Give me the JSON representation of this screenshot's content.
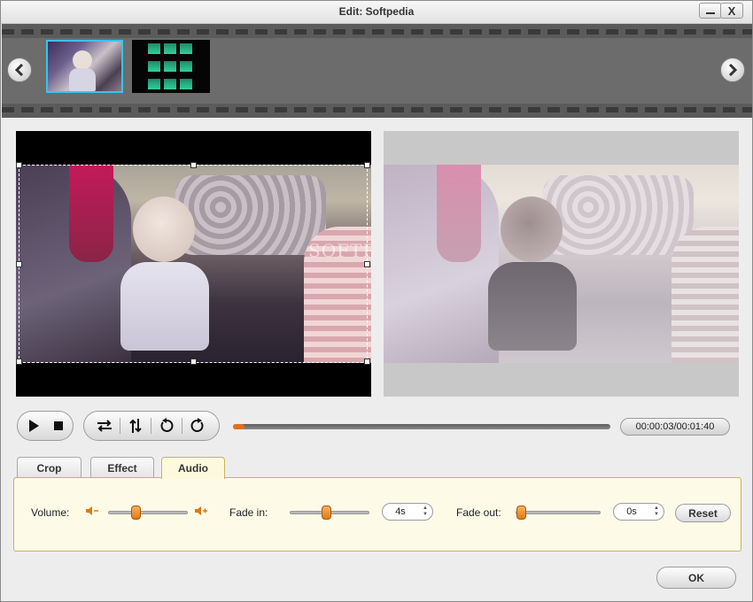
{
  "window": {
    "title": "Edit: Softpedia"
  },
  "titlebar": {
    "minimize_icon": "minimize-icon",
    "close_label": "X"
  },
  "filmstrip": {
    "prev_icon": "chevron-left-icon",
    "next_icon": "chevron-right-icon",
    "selected_index": 0,
    "clip_count": 2
  },
  "preview": {
    "watermark": "SOFTPEDIA"
  },
  "player": {
    "timecode": "00:00:03/00:01:40",
    "progress_fraction": 0.03,
    "icons": [
      "play-icon",
      "stop-icon",
      "flip-horizontal-icon",
      "flip-vertical-icon",
      "rotate-left-icon",
      "rotate-right-icon"
    ]
  },
  "tabs": [
    {
      "label": "Crop",
      "active": false
    },
    {
      "label": "Effect",
      "active": false
    },
    {
      "label": "Audio",
      "active": true
    }
  ],
  "audio": {
    "volume_label": "Volume:",
    "volume_fraction": 0.33,
    "fade_in_label": "Fade in:",
    "fade_in_value": "4s",
    "fade_in_fraction": 0.45,
    "fade_out_label": "Fade out:",
    "fade_out_value": "0s",
    "fade_out_fraction": 0.0,
    "reset_label": "Reset"
  },
  "footer": {
    "ok_label": "OK"
  },
  "colors": {
    "accent": "#e07a12",
    "selected_border": "#33c6f2",
    "panel_border": "#c9b45f"
  }
}
